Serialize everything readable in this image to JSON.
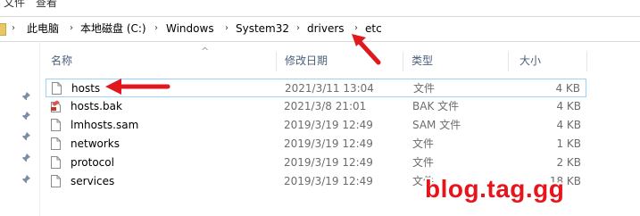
{
  "ribbon": {
    "tabs": [
      "文件",
      "查看"
    ]
  },
  "address": {
    "crumbs": [
      "此电脑",
      "本地磁盘 (C:)",
      "Windows",
      "System32",
      "drivers",
      "etc"
    ]
  },
  "columns": {
    "name": "名称",
    "date": "修改日期",
    "type": "类型",
    "size": "大小"
  },
  "files": [
    {
      "name": "hosts",
      "date": "2021/3/11 13:04",
      "type": "文件",
      "size": "4 KB",
      "icon": "file-icon"
    },
    {
      "name": "hosts.bak",
      "date": "2021/3/8 21:01",
      "type": "BAK 文件",
      "size": "4 KB",
      "icon": "bak-file-icon"
    },
    {
      "name": "lmhosts.sam",
      "date": "2019/3/19 12:49",
      "type": "SAM 文件",
      "size": "4 KB",
      "icon": "file-icon"
    },
    {
      "name": "networks",
      "date": "2019/3/19 12:49",
      "type": "文件",
      "size": "1 KB",
      "icon": "file-icon"
    },
    {
      "name": "protocol",
      "date": "2019/3/19 12:49",
      "type": "文件",
      "size": "2 KB",
      "icon": "file-icon"
    },
    {
      "name": "services",
      "date": "2019/3/19 12:49",
      "type": "文件",
      "size": "18 KB",
      "icon": "file-icon"
    }
  ],
  "watermark": "blog.tag.gg",
  "colors": {
    "arrow": "#e0191f",
    "watermark": "#e8141c",
    "selection_border": "#99d1ff",
    "header_text": "#4c607a"
  }
}
